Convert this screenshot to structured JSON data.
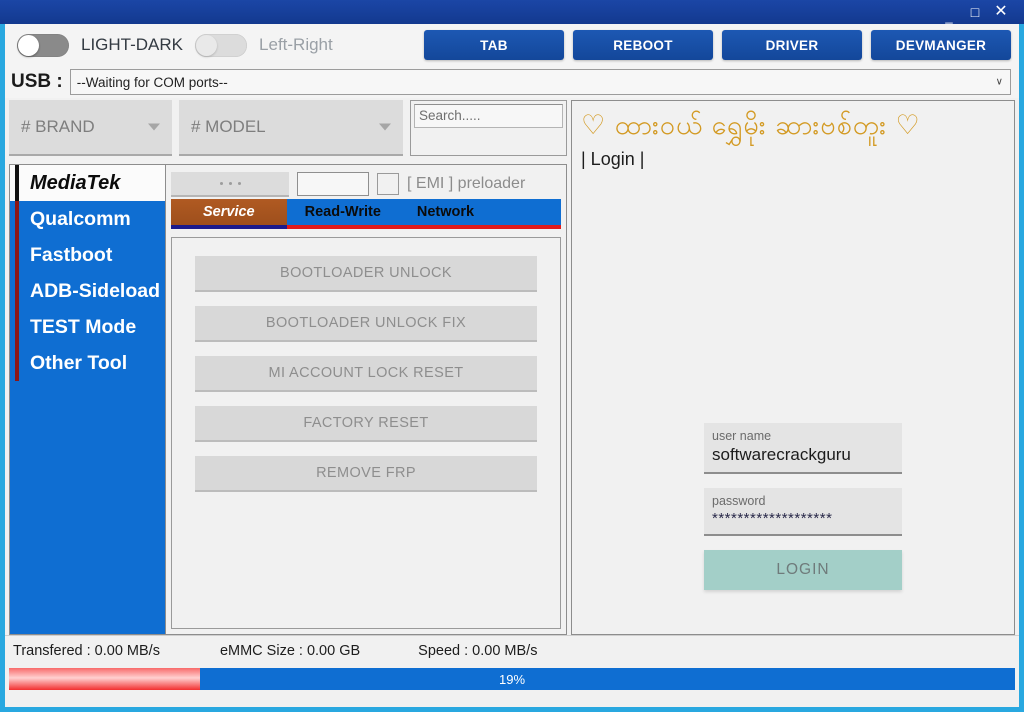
{
  "window": {
    "minimize": "_",
    "maximize": "□",
    "close": "✕"
  },
  "toolbar": {
    "theme_toggle_label": "LIGHT-DARK",
    "layout_toggle_label": "Left-Right",
    "buttons": [
      {
        "label": "TAB"
      },
      {
        "label": "REBOOT"
      },
      {
        "label": "DRIVER"
      },
      {
        "label": "DEVMANGER"
      }
    ]
  },
  "usb": {
    "label": "USB :",
    "value": "--Waiting for COM ports--",
    "chevron": "∨"
  },
  "pickers": {
    "brand": "# BRAND",
    "model": "# MODEL",
    "search_placeholder": "Search....."
  },
  "sidebar": {
    "items": [
      {
        "label": "MediaTek",
        "active": true
      },
      {
        "label": "Qualcomm",
        "active": false
      },
      {
        "label": "Fastboot",
        "active": false
      },
      {
        "label": "ADB-Sideload",
        "active": false
      },
      {
        "label": "TEST Mode",
        "active": false
      },
      {
        "label": "Other Tool",
        "active": false
      }
    ]
  },
  "emi": {
    "dots": "· · ·",
    "input_value": "",
    "checkbox_checked": false,
    "label": "[ EMI ] preloader"
  },
  "tabs": [
    {
      "label": "Service",
      "active": true
    },
    {
      "label": "Read-Write",
      "active": false
    },
    {
      "label": "Network",
      "active": false
    }
  ],
  "actions": [
    {
      "label": "BOOTLOADER UNLOCK"
    },
    {
      "label": "BOOTLOADER UNLOCK FIX"
    },
    {
      "label": "MI ACCOUNT LOCK RESET"
    },
    {
      "label": "FACTORY RESET"
    },
    {
      "label": "REMOVE FRP"
    }
  ],
  "right_panel": {
    "heart_left": "♡",
    "heart_right": "♡",
    "brand_title": "ထားဝယ် ရွှေမိုး ဆားဗစ်တူး",
    "login_link": "| Login |",
    "username_label": "user name",
    "username_value": "softwarecrackguru",
    "password_label": "password",
    "password_value": "*******************",
    "login_button": "LOGIN"
  },
  "status": {
    "transfered": "Transfered  : 0.00 MB/s",
    "emmc_size": "eMMC Size : 0.00 GB",
    "speed": "Speed : 0.00 MB/s"
  },
  "progress": {
    "percent_label": "19%",
    "percent": 19
  },
  "colors": {
    "titlebar": "#1a47a8",
    "accent_blue": "#0f6ed2",
    "button_blue": "#1851a8",
    "window_border": "#29a8e0",
    "tab_active": "#a8561f",
    "brand_gold": "#d39a23",
    "login_teal": "#a3cfc8",
    "progress_red": "#f23030",
    "sidebar_indicator": "#8c1616"
  }
}
